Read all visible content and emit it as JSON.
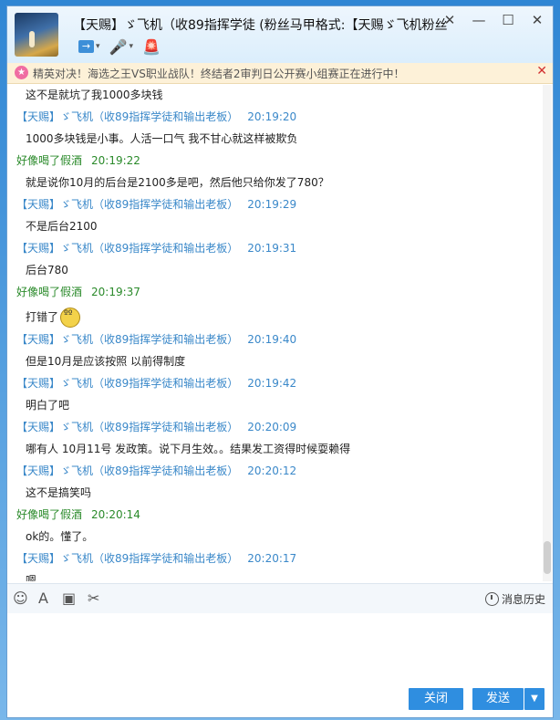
{
  "window": {
    "title": "【天赐】ゞ飞机（收89指挥学徒 (粉丝马甲格式:【天赐ゞ飞机粉丝",
    "controls": [
      "✕",
      "—",
      "☐",
      "✕"
    ]
  },
  "toolbar_top": {
    "share_icon": "→",
    "caret": "▾",
    "mic_icon": "🎤",
    "alarm_icon": "🚨"
  },
  "banner": {
    "icon": "★",
    "text": "精英对决！海选之王VS职业战队！终结者2审判日公开赛小组赛正在进行中！",
    "close": "✕"
  },
  "messages": [
    {
      "sender": "",
      "time": "",
      "text": "这不是就坑了我1000多块钱",
      "who": "other"
    },
    {
      "sender": "【天赐】ゞ飞机（收89指挥学徒和输出老板）",
      "time": "20:19:20",
      "text": "1000多块钱是小事。人活一口气 我不甘心就这样被欺负",
      "who": "other"
    },
    {
      "sender": "好像喝了假酒",
      "time": "20:19:22",
      "text": "就是说你10月的后台是2100多是吧，然后他只给你发了780？",
      "who": "me"
    },
    {
      "sender": "【天赐】ゞ飞机（收89指挥学徒和输出老板）",
      "time": "20:19:29",
      "text": "不是后台2100",
      "who": "other"
    },
    {
      "sender": "【天赐】ゞ飞机（收89指挥学徒和输出老板）",
      "time": "20:19:31",
      "text": "后台780",
      "who": "other"
    },
    {
      "sender": "好像喝了假酒",
      "time": "20:19:37",
      "text": "打错了",
      "who": "me",
      "emoji": true
    },
    {
      "sender": "【天赐】ゞ飞机（收89指挥学徒和输出老板）",
      "time": "20:19:40",
      "text": "但是10月是应该按照 以前得制度",
      "who": "other"
    },
    {
      "sender": "【天赐】ゞ飞机（收89指挥学徒和输出老板）",
      "time": "20:19:42",
      "text": "明白了吧",
      "who": "other"
    },
    {
      "sender": "【天赐】ゞ飞机（收89指挥学徒和输出老板）",
      "time": "20:20:09",
      "text": "哪有人 10月11号 发政策。说下月生效。。结果发工资得时候耍赖得",
      "who": "other"
    },
    {
      "sender": "【天赐】ゞ飞机（收89指挥学徒和输出老板）",
      "time": "20:20:12",
      "text": "这不是搞笑吗",
      "who": "other"
    },
    {
      "sender": "好像喝了假酒",
      "time": "20:20:14",
      "text": "ok的。懂了。",
      "who": "me"
    },
    {
      "sender": "【天赐】ゞ飞机（收89指挥学徒和输出老板）",
      "time": "20:20:17",
      "text": "嗯",
      "who": "other"
    }
  ],
  "input_toolbar": {
    "emoji_icon": "☺",
    "font_icon": "A",
    "image_icon": "▣",
    "scissors_icon": "✂",
    "history_label": "消息历史"
  },
  "buttons": {
    "close": "关闭",
    "send": "发送",
    "send_menu": "▼"
  }
}
